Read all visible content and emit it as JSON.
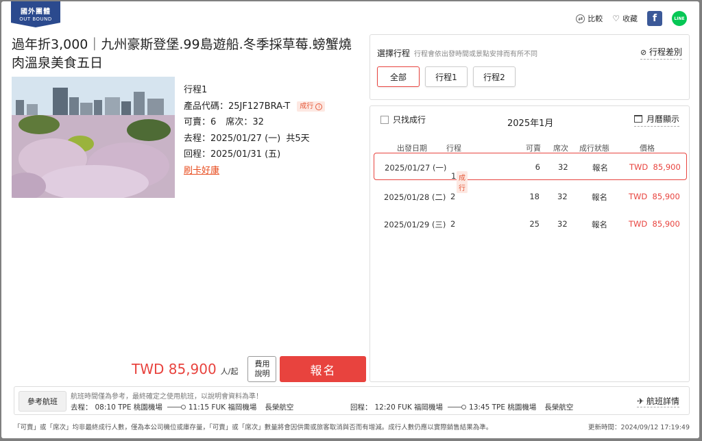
{
  "badge": {
    "line1": "國外團體",
    "line2": "OUT BOUND"
  },
  "top_actions": {
    "compare": "比較",
    "favorite": "收藏"
  },
  "title": "過年折3,000｜九州豪斯登堡.99島遊船.冬季採草莓.螃蟹燒肉溫泉美食五日",
  "info": {
    "trip": "行程1",
    "code_label": "產品代碼：",
    "code": "25JF127BRA-T",
    "status_tag": "成行",
    "avail_label": "可賣：",
    "avail": "6",
    "seats_label": "席次：",
    "seats": "32",
    "depart_label": "去程：",
    "depart": "2025/01/27 (一)",
    "days": "共5天",
    "return_label": "回程：",
    "return": "2025/01/31 (五)",
    "promo": "刷卡好康"
  },
  "purchase": {
    "price": "TWD 85,900",
    "per": "人/起",
    "fee_l1": "費用",
    "fee_l2": "說明",
    "book": "報名"
  },
  "select_panel": {
    "label": "選擇行程",
    "note": "行程會依出發時間或景點安排而有所不同",
    "diff": "行程差別",
    "tabs": [
      "全部",
      "行程1",
      "行程2"
    ]
  },
  "date_panel": {
    "only_confirmed": "只找成行",
    "month": "2025年1月",
    "calendar_view": "月曆顯示",
    "headers": {
      "date": "出發日期",
      "trip": "行程",
      "avail": "可賣",
      "seats": "席次",
      "status": "成行狀態",
      "price": "價格"
    },
    "rows": [
      {
        "date": "2025/01/27 (一)",
        "trip": "1",
        "tag": "成行",
        "avail": "6",
        "seats": "32",
        "status": "報名",
        "price": "TWD  85,900"
      },
      {
        "date": "2025/01/28 (二)",
        "trip": "2",
        "tag": "",
        "avail": "18",
        "seats": "32",
        "status": "報名",
        "price": "TWD  85,900"
      },
      {
        "date": "2025/01/29 (三)",
        "trip": "2",
        "tag": "",
        "avail": "25",
        "seats": "32",
        "status": "報名",
        "price": "TWD  85,900"
      }
    ]
  },
  "flight": {
    "ref_button": "參考航班",
    "note": "航班時間僅為參考，最終確定之使用航班，以說明會資料為準！",
    "out_label": "去程：",
    "out_dep": "08:10 TPE 桃園機場",
    "out_arr": "11:15 FUK 福岡機場",
    "out_airline": "長榮航空",
    "ret_label": "回程：",
    "ret_dep": "12:20 FUK 福岡機場",
    "ret_arr": "13:45 TPE 桃園機場",
    "ret_airline": "長榮航空",
    "details": "航班詳情"
  },
  "footer": {
    "note": "「可賣」或「席次」均非最終成行人數，僅為本公司機位或庫存量，「可賣」或「席次」數量將會因供需或旅客取消與否而有增減。成行人數仍應以實際銷售結果為準。",
    "updated": "更新時間：2024/09/12 17:19:49"
  }
}
